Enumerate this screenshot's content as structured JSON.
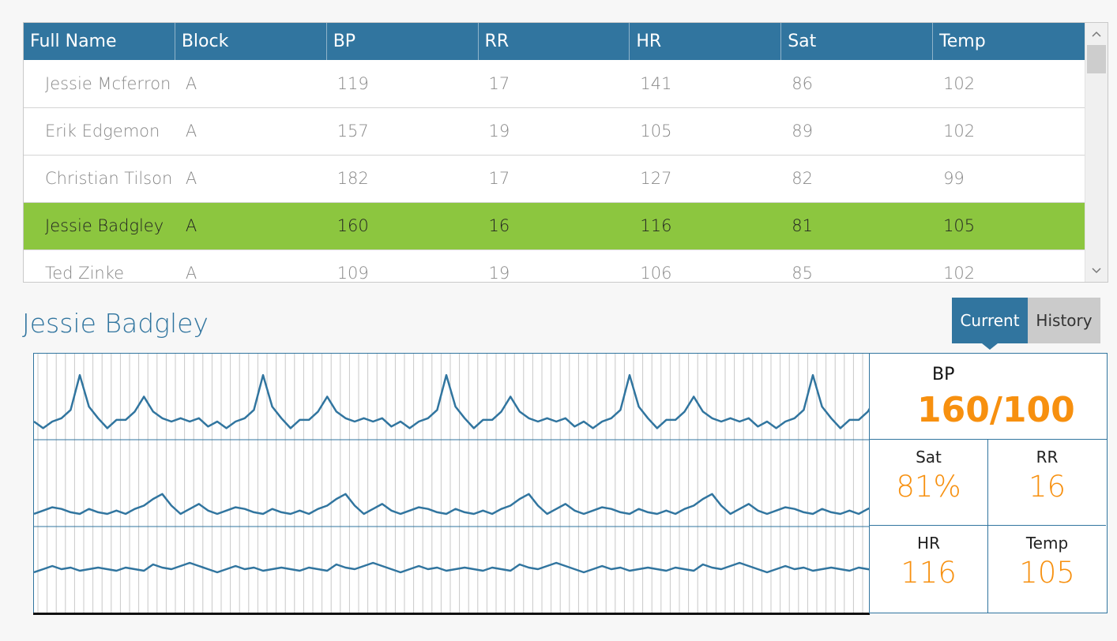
{
  "grid": {
    "columns": [
      "Full Name",
      "Block",
      "BP",
      "RR",
      "HR",
      "Sat",
      "Temp"
    ],
    "rows": [
      [
        "Jessie Mcferron",
        "A",
        "119",
        "17",
        "141",
        "86",
        "102"
      ],
      [
        "Erik Edgemon",
        "A",
        "157",
        "19",
        "105",
        "89",
        "102"
      ],
      [
        "Christian Tilson",
        "A",
        "182",
        "17",
        "127",
        "82",
        "99"
      ],
      [
        "Jessie Badgley",
        "A",
        "160",
        "16",
        "116",
        "81",
        "105"
      ],
      [
        "Ted Zinke",
        "A",
        "109",
        "19",
        "106",
        "85",
        "102"
      ]
    ],
    "selected_row": 3
  },
  "patient": {
    "name": "Jessie Badgley"
  },
  "tabs": {
    "current": "Current",
    "history": "History",
    "active": "current"
  },
  "vitals": {
    "bp": {
      "label": "BP",
      "value": "160/100"
    },
    "sat": {
      "label": "Sat",
      "value": "81%"
    },
    "rr": {
      "label": "RR",
      "value": "16"
    },
    "hr": {
      "label": "HR",
      "value": "116"
    },
    "temp": {
      "label": "Temp",
      "value": "105"
    }
  },
  "colors": {
    "accent": "#31759f",
    "selected_row": "#8cc63f",
    "vital_value": "#f7900f"
  },
  "icons": {
    "scroll_up": "chevron-up-icon",
    "scroll_down": "chevron-down-icon"
  }
}
